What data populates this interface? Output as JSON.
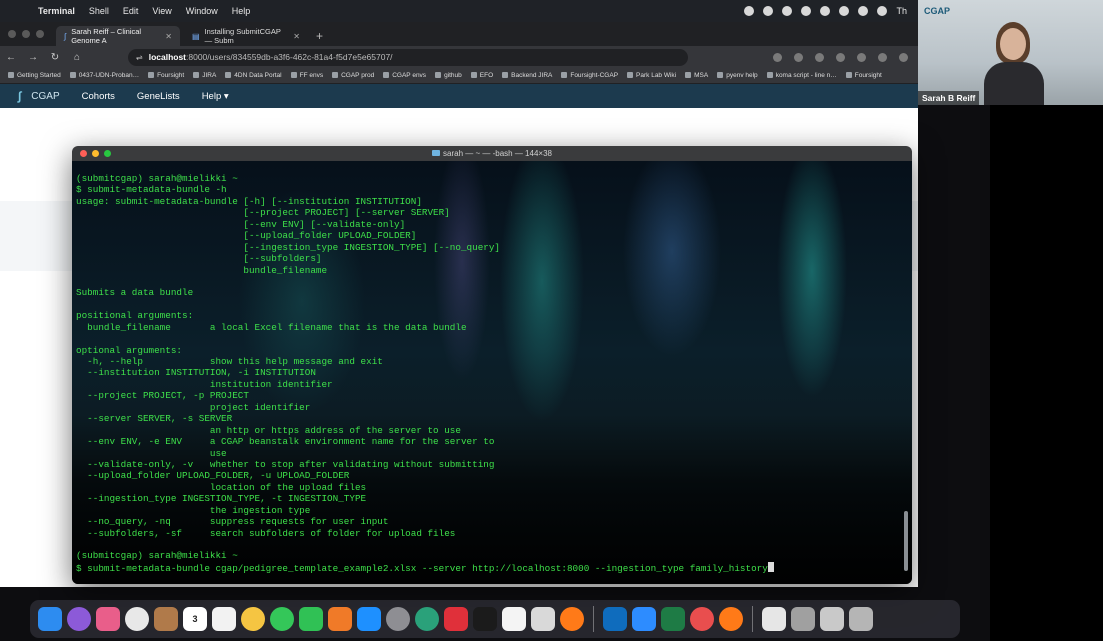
{
  "menubar": {
    "app": "Terminal",
    "items": [
      "Shell",
      "Edit",
      "View",
      "Window",
      "Help"
    ],
    "clock_fragment": "Th"
  },
  "browser": {
    "tabs": [
      {
        "title": "Sarah Reiff – Clinical Genome A"
      },
      {
        "title": "Installing SubmitCGAP — Subm"
      }
    ],
    "url_host": "localhost",
    "url_path": ":8000/users/834559db-a3f6-462c-81a4-f5d7e5e65707/",
    "bookmarks": [
      "Getting Started",
      "0437-UDN-Proban…",
      "Foursight",
      "JIRA",
      "4DN Data Portal",
      "FF envs",
      "CGAP prod",
      "CGAP envs",
      "github",
      "EFO",
      "Backend JIRA",
      "Foursight-CGAP",
      "Park Lab Wiki",
      "MSA",
      "pyenv help",
      "koma script - line n…",
      "Foursight"
    ]
  },
  "cgap_nav": {
    "brand": "CGAP",
    "links": [
      "Cohorts",
      "GeneLists",
      "Help ▾"
    ]
  },
  "terminal": {
    "title": "sarah — ~ — -bash — 144×38",
    "lines": [
      "(submitcgap) sarah@mielikki ~",
      "$ submit-metadata-bundle -h",
      "usage: submit-metadata-bundle [-h] [--institution INSTITUTION]",
      "                              [--project PROJECT] [--server SERVER]",
      "                              [--env ENV] [--validate-only]",
      "                              [--upload_folder UPLOAD_FOLDER]",
      "                              [--ingestion_type INGESTION_TYPE] [--no_query]",
      "                              [--subfolders]",
      "                              bundle_filename",
      "",
      "Submits a data bundle",
      "",
      "positional arguments:",
      "  bundle_filename       a local Excel filename that is the data bundle",
      "",
      "optional arguments:",
      "  -h, --help            show this help message and exit",
      "  --institution INSTITUTION, -i INSTITUTION",
      "                        institution identifier",
      "  --project PROJECT, -p PROJECT",
      "                        project identifier",
      "  --server SERVER, -s SERVER",
      "                        an http or https address of the server to use",
      "  --env ENV, -e ENV     a CGAP beanstalk environment name for the server to",
      "                        use",
      "  --validate-only, -v   whether to stop after validating without submitting",
      "  --upload_folder UPLOAD_FOLDER, -u UPLOAD_FOLDER",
      "                        location of the upload files",
      "  --ingestion_type INGESTION_TYPE, -t INGESTION_TYPE",
      "                        the ingestion type",
      "  --no_query, -nq       suppress requests for user input",
      "  --subfolders, -sf     search subfolders of folder for upload files",
      "",
      "(submitcgap) sarah@mielikki ~",
      "$ submit-metadata-bundle cgap/pedigree_template_example2.xlsx --server http://localhost:8000 --ingestion_type family_history"
    ]
  },
  "dock": {
    "calendar_date": "3"
  },
  "zoom": {
    "participant_name": "Sarah B Reiff",
    "logo_text": "CGAP"
  },
  "colors": {
    "terminal_text": "#3ee04a",
    "cgap_nav_bg": "#1c3a4e",
    "browser_chrome": "#35363a"
  }
}
